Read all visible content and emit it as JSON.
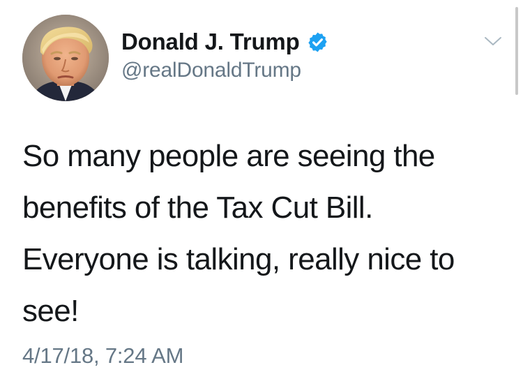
{
  "author": {
    "display_name": "Donald J. Trump",
    "handle": "@realDonaldTrump",
    "verified": true
  },
  "tweet": {
    "lines": [
      "So many people are seeing the",
      "benefits of the Tax Cut Bill.",
      "Everyone is talking, really nice to",
      "see!"
    ],
    "timestamp": "4/17/18, 7:24 AM"
  },
  "icons": {
    "verified": "verified-badge-icon",
    "menu": "chevron-down-icon"
  },
  "colors": {
    "verified_blue": "#1da1f2",
    "secondary_text": "#657786",
    "primary_text": "#14171a",
    "chevron": "#aab8c2"
  }
}
